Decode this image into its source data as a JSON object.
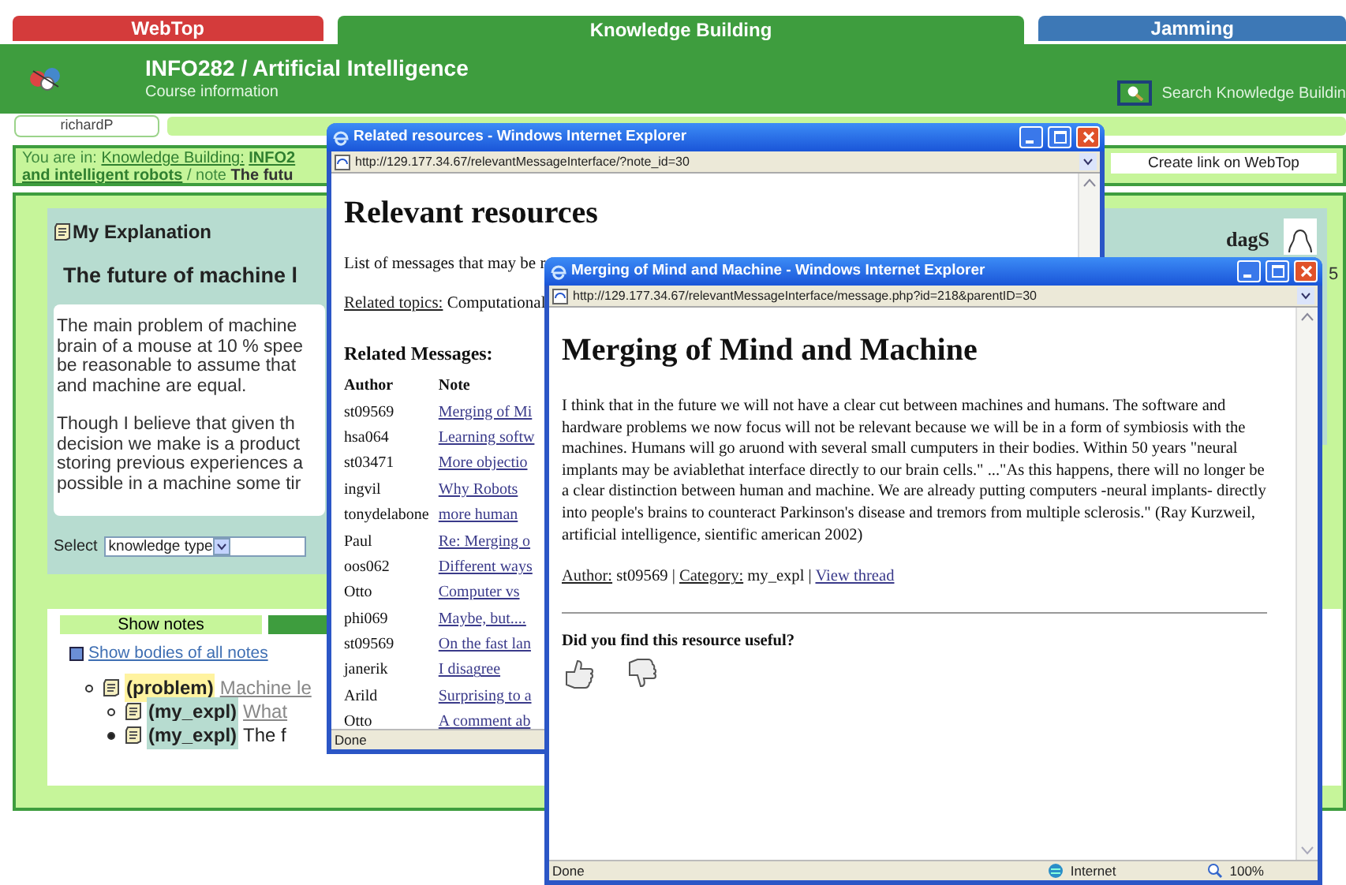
{
  "app_tabs": [
    {
      "label": "WebTop",
      "color": "#d43b3b",
      "selected": false
    },
    {
      "label": "Knowledge Building",
      "color": "#3e9d3e",
      "selected": true
    },
    {
      "label": "Jamming",
      "color": "#3d78b6",
      "selected": false
    }
  ],
  "header": {
    "title": "INFO282 / Artificial Intelligence",
    "subtitle": "Course information",
    "search_label": "Search Knowledge Buildin"
  },
  "user_field": {
    "value": "richardP"
  },
  "breadcrumb": [
    [
      {
        "text": "You are in:",
        "kind": "plain"
      },
      {
        "text": "Knowledge Building:",
        "kind": "link"
      },
      {
        "text": "INFO2",
        "kind": "bold-link"
      }
    ],
    [
      {
        "text": "and intelligent robots",
        "kind": "bold-link"
      },
      {
        "text": "/ note",
        "kind": "plain"
      },
      {
        "text": "The futu",
        "kind": "bold"
      }
    ]
  ],
  "create_link_button": "Create link on WebTop",
  "explanation": {
    "type_label": "My Explanation",
    "title": "The future of machine l",
    "paragraphs": [
      [
        "The main problem of machine",
        "brain of a mouse at 10 % spee",
        "be reasonable to assume that",
        "and machine are equal."
      ],
      [
        "Though I believe that given th",
        "decision we make is a product",
        "storing previous experiences a",
        "possible in a machine some tir"
      ]
    ],
    "select_label": "Select",
    "select_value": "knowledge type"
  },
  "author_card": {
    "name": "dagS",
    "number": "5"
  },
  "notes": {
    "tab_label": "Show notes",
    "show_bodies_link": "Show bodies of all notes",
    "tree": [
      {
        "category": "(problem)",
        "kind": "problem",
        "title": "Machine le",
        "link": true,
        "has_children": true,
        "children": [
          {
            "category": "(my_expl)",
            "kind": "my_expl",
            "title": "What",
            "link": true,
            "has_children": true
          },
          {
            "category": "(my_expl)",
            "kind": "my_expl",
            "title": "The f",
            "link": false,
            "has_children": false
          }
        ]
      }
    ]
  },
  "related_window": {
    "title": "Related resources - Windows Internet Explorer",
    "url": "http://129.177.34.67/relevantMessageInterface/?note_id=30",
    "heading": "Relevant resources",
    "intro": "List of messages that may be r",
    "topics_label": "Related topics:",
    "topics_value": "Computational",
    "messages_heading": "Related Messages:",
    "columns": [
      "Author",
      "Note"
    ],
    "rows": [
      {
        "author": "st09569",
        "note": "Merging of Mi"
      },
      {
        "author": "hsa064",
        "note": "Learning softw"
      },
      {
        "author": "st03471",
        "note": "More objectio"
      },
      {
        "author": "ingvil",
        "note": "Why Robots"
      },
      {
        "author": "tonydelabone",
        "note": "more human"
      },
      {
        "author": "Paul",
        "note": "Re: Merging o"
      },
      {
        "author": "oos062",
        "note": "Different ways"
      },
      {
        "author": "Otto",
        "note": "Computer vs"
      },
      {
        "author": "phi069",
        "note": "Maybe, but...."
      },
      {
        "author": "st09569",
        "note": "On the fast lan"
      },
      {
        "author": "janerik",
        "note": "I disagree"
      },
      {
        "author": "Arild",
        "note": "Surprising to a"
      },
      {
        "author": "Otto",
        "note": "A comment ab"
      }
    ],
    "status": "Done"
  },
  "message_window": {
    "title": "Merging of Mind and Machine - Windows Internet Explorer",
    "url": "http://129.177.34.67/relevantMessageInterface/message.php?id=218&parentID=30",
    "heading": "Merging of Mind and Machine",
    "body": "I think that in the future we will not have a clear cut between machines and humans. The software and hardware problems we now focus will not be relevant because we will be in a form of symbiosis with the machines. Humans will go aruond with several small cumputers in their bodies. Within 50 years \"neural implants may be aviablethat interface directly to our brain cells.\" ...\"As this happens, there will no longer be a clear distinction between human and machine. We are already putting computers -neural implants- directly into people's brains to counteract Parkinson's disease and tremors from multiple sclerosis.\" (Ray Kurzweil, artificial intelligence, sientific american 2002)",
    "meta": [
      {
        "label": "Author:",
        "value": "st09569"
      },
      {
        "label": "Category:",
        "value": "my_expl"
      }
    ],
    "separator": "|",
    "thread_link": "View thread",
    "question": "Did you find this resource useful?",
    "status": "Done",
    "zone": "Internet",
    "zoom": "100%"
  }
}
